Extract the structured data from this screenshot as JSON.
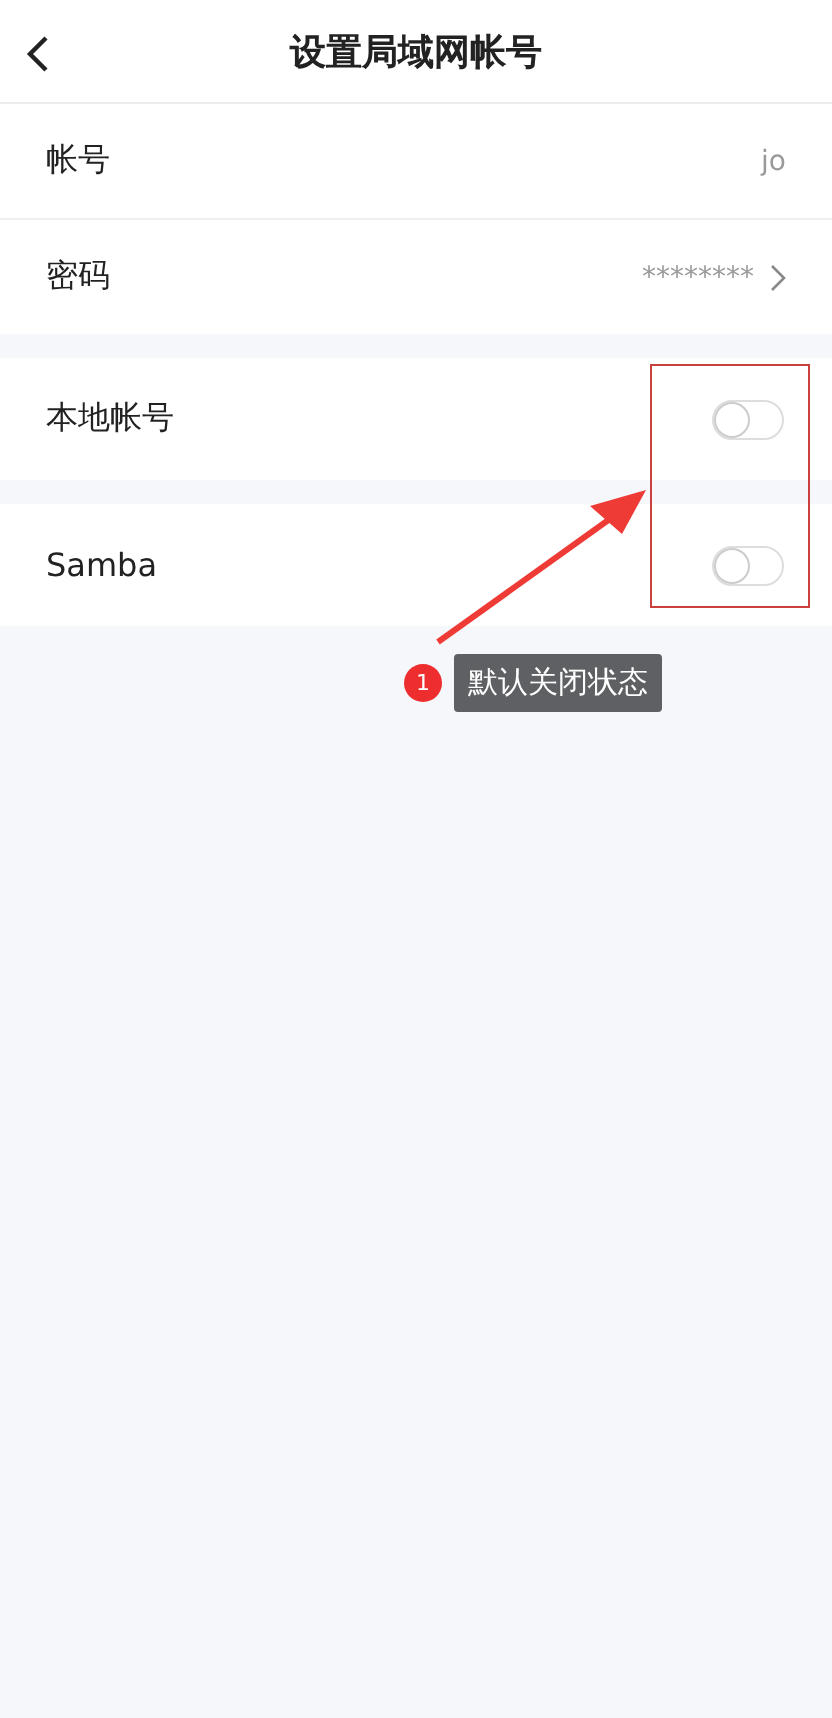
{
  "header": {
    "title": "设置局域网帐号"
  },
  "account_rows": [
    {
      "label": "帐号",
      "value": "jo",
      "chevron": false
    },
    {
      "label": "密码",
      "value": "********",
      "chevron": true
    }
  ],
  "toggle_rows": [
    {
      "label": "本地帐号",
      "on": false
    },
    {
      "label": "Samba",
      "on": false
    }
  ],
  "annotation": {
    "number": "1",
    "text": "默认关闭状态"
  }
}
